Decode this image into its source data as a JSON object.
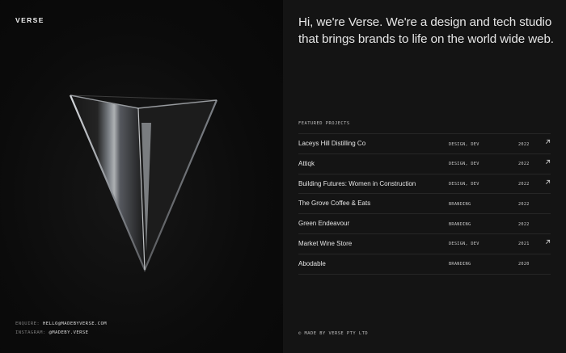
{
  "brand": {
    "logo": "VERSE"
  },
  "intro": {
    "text": "Hi, we're Verse. We're a design and tech studio that brings brands to life on the world wide web."
  },
  "projects": {
    "label": "FEATURED PROJECTS",
    "items": [
      {
        "name": "Laceys Hill Distilling Co",
        "tags": "DESIGN, DEV",
        "year": "2022",
        "arrow": true
      },
      {
        "name": "Attiqk",
        "tags": "DESIGN, DEV",
        "year": "2022",
        "arrow": true
      },
      {
        "name": "Building Futures: Women in Construction",
        "tags": "DESIGN, DEV",
        "year": "2022",
        "arrow": true
      },
      {
        "name": "The Grove Coffee & Eats",
        "tags": "BRANDING",
        "year": "2022",
        "arrow": false
      },
      {
        "name": "Green Endeavour",
        "tags": "BRANDING",
        "year": "2022",
        "arrow": false
      },
      {
        "name": "Market Wine Store",
        "tags": "DESIGN, DEV",
        "year": "2021",
        "arrow": true
      },
      {
        "name": "Abodable",
        "tags": "BRANDING",
        "year": "2020",
        "arrow": false
      }
    ]
  },
  "contact": {
    "enquire_label": "ENQUIRE:",
    "enquire_value": "HELLO@MADEBYVERSE.COM",
    "instagram_label": "INSTAGRAM:",
    "instagram_value": "@MADEBY.VERSE"
  },
  "footer": {
    "text": "© MADE BY VERSE PTY LTD"
  },
  "icons": {
    "project_link": "arrow-up-right-icon",
    "hero": "glass-triangle-graphic"
  },
  "colors": {
    "background": "#0b0b0b",
    "panel": "#141414",
    "text": "#e6e6e6",
    "muted": "#7b7b7b",
    "divider": "#262626"
  }
}
